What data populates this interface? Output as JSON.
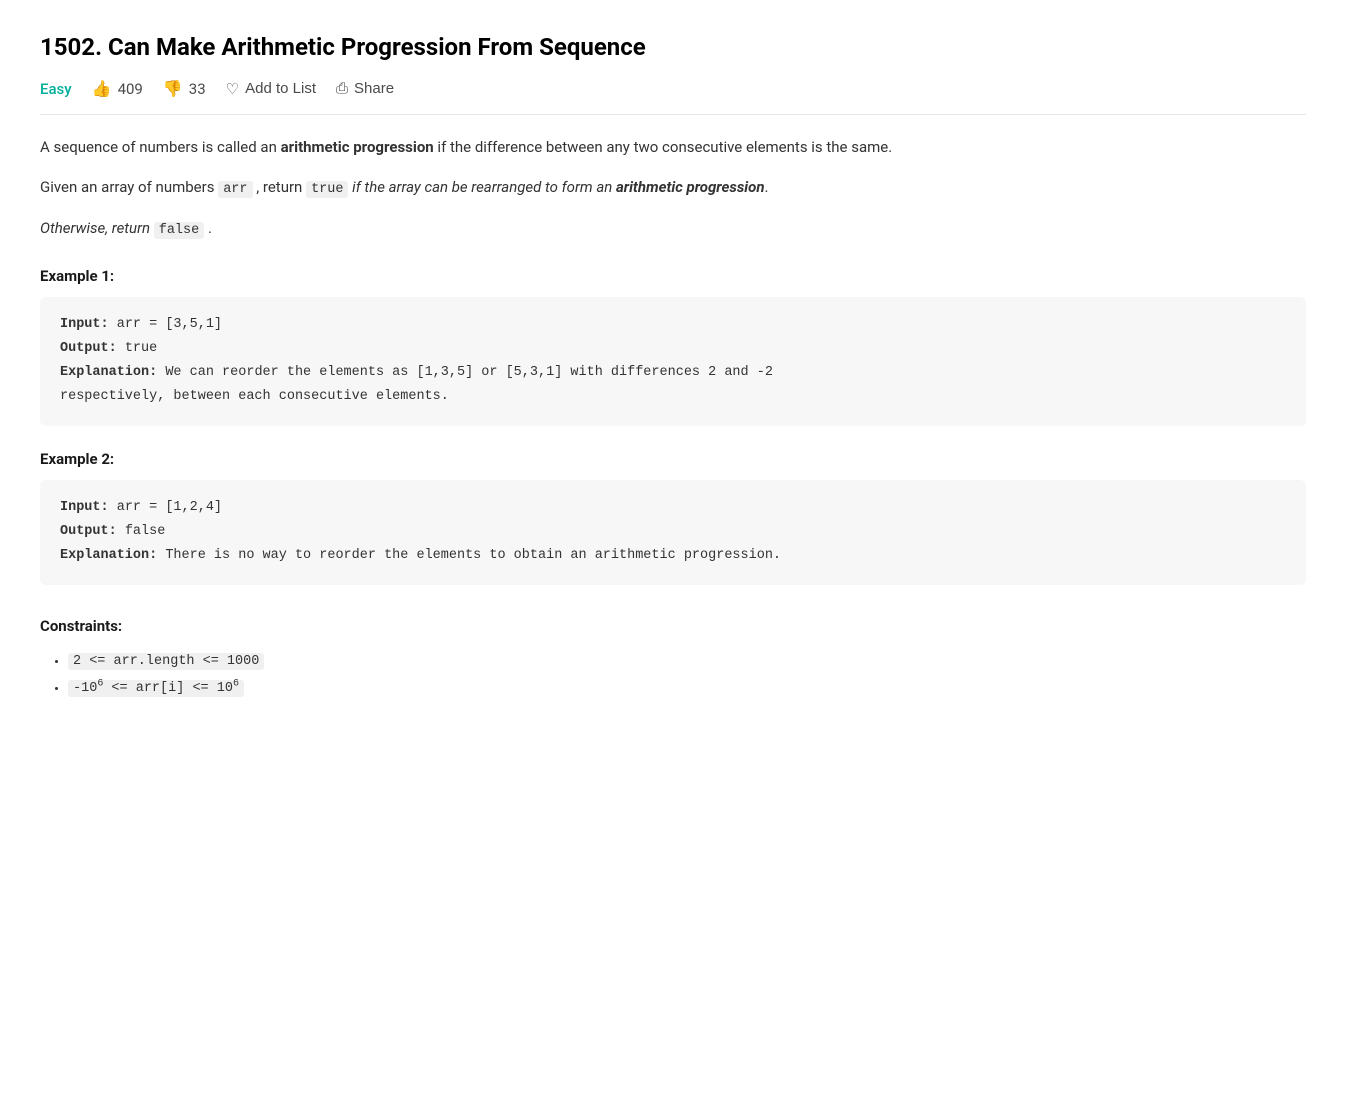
{
  "page": {
    "title": "1502. Can Make Arithmetic Progression From Sequence",
    "difficulty": "Easy",
    "upvotes": "409",
    "downvotes": "33",
    "addToList": "Add to List",
    "share": "Share",
    "description_p1_pre": "A sequence of numbers is called an ",
    "description_p1_bold": "arithmetic progression",
    "description_p1_post": " if the difference between any two consecutive elements is the same.",
    "description_p2_pre": "Given an array of numbers ",
    "description_p2_code1": "arr",
    "description_p2_mid1": " , return ",
    "description_p2_code2": "true",
    "description_p2_italic_pre": " if the array can be rearranged to form an ",
    "description_p2_italic_bold": "arithmetic progression",
    "description_p2_italic_post": ".",
    "description_p3_pre": "Otherwise, return ",
    "description_p3_code": "false",
    "description_p3_post": " .",
    "example1_title": "Example 1:",
    "example1_input_label": "Input:",
    "example1_input_value": "arr = [3,5,1]",
    "example1_output_label": "Output:",
    "example1_output_value": "true",
    "example1_explanation_label": "Explanation:",
    "example1_explanation_value": "We can reorder the elements as [1,3,5] or [5,3,1] with differences 2 and -2",
    "example1_explanation_cont": "respectively, between each consecutive elements.",
    "example2_title": "Example 2:",
    "example2_input_label": "Input:",
    "example2_input_value": "arr = [1,2,4]",
    "example2_output_label": "Output:",
    "example2_output_value": "false",
    "example2_explanation_label": "Explanation:",
    "example2_explanation_value": "There is no way to reorder the elements to obtain an arithmetic progression.",
    "constraints_title": "Constraints:",
    "constraint1_pre": "2 <= arr.length <= 1000",
    "constraint2_pre": "-10",
    "constraint2_sup": "6",
    "constraint2_mid": " <= arr[i] <= 10",
    "constraint2_sup2": "6"
  }
}
